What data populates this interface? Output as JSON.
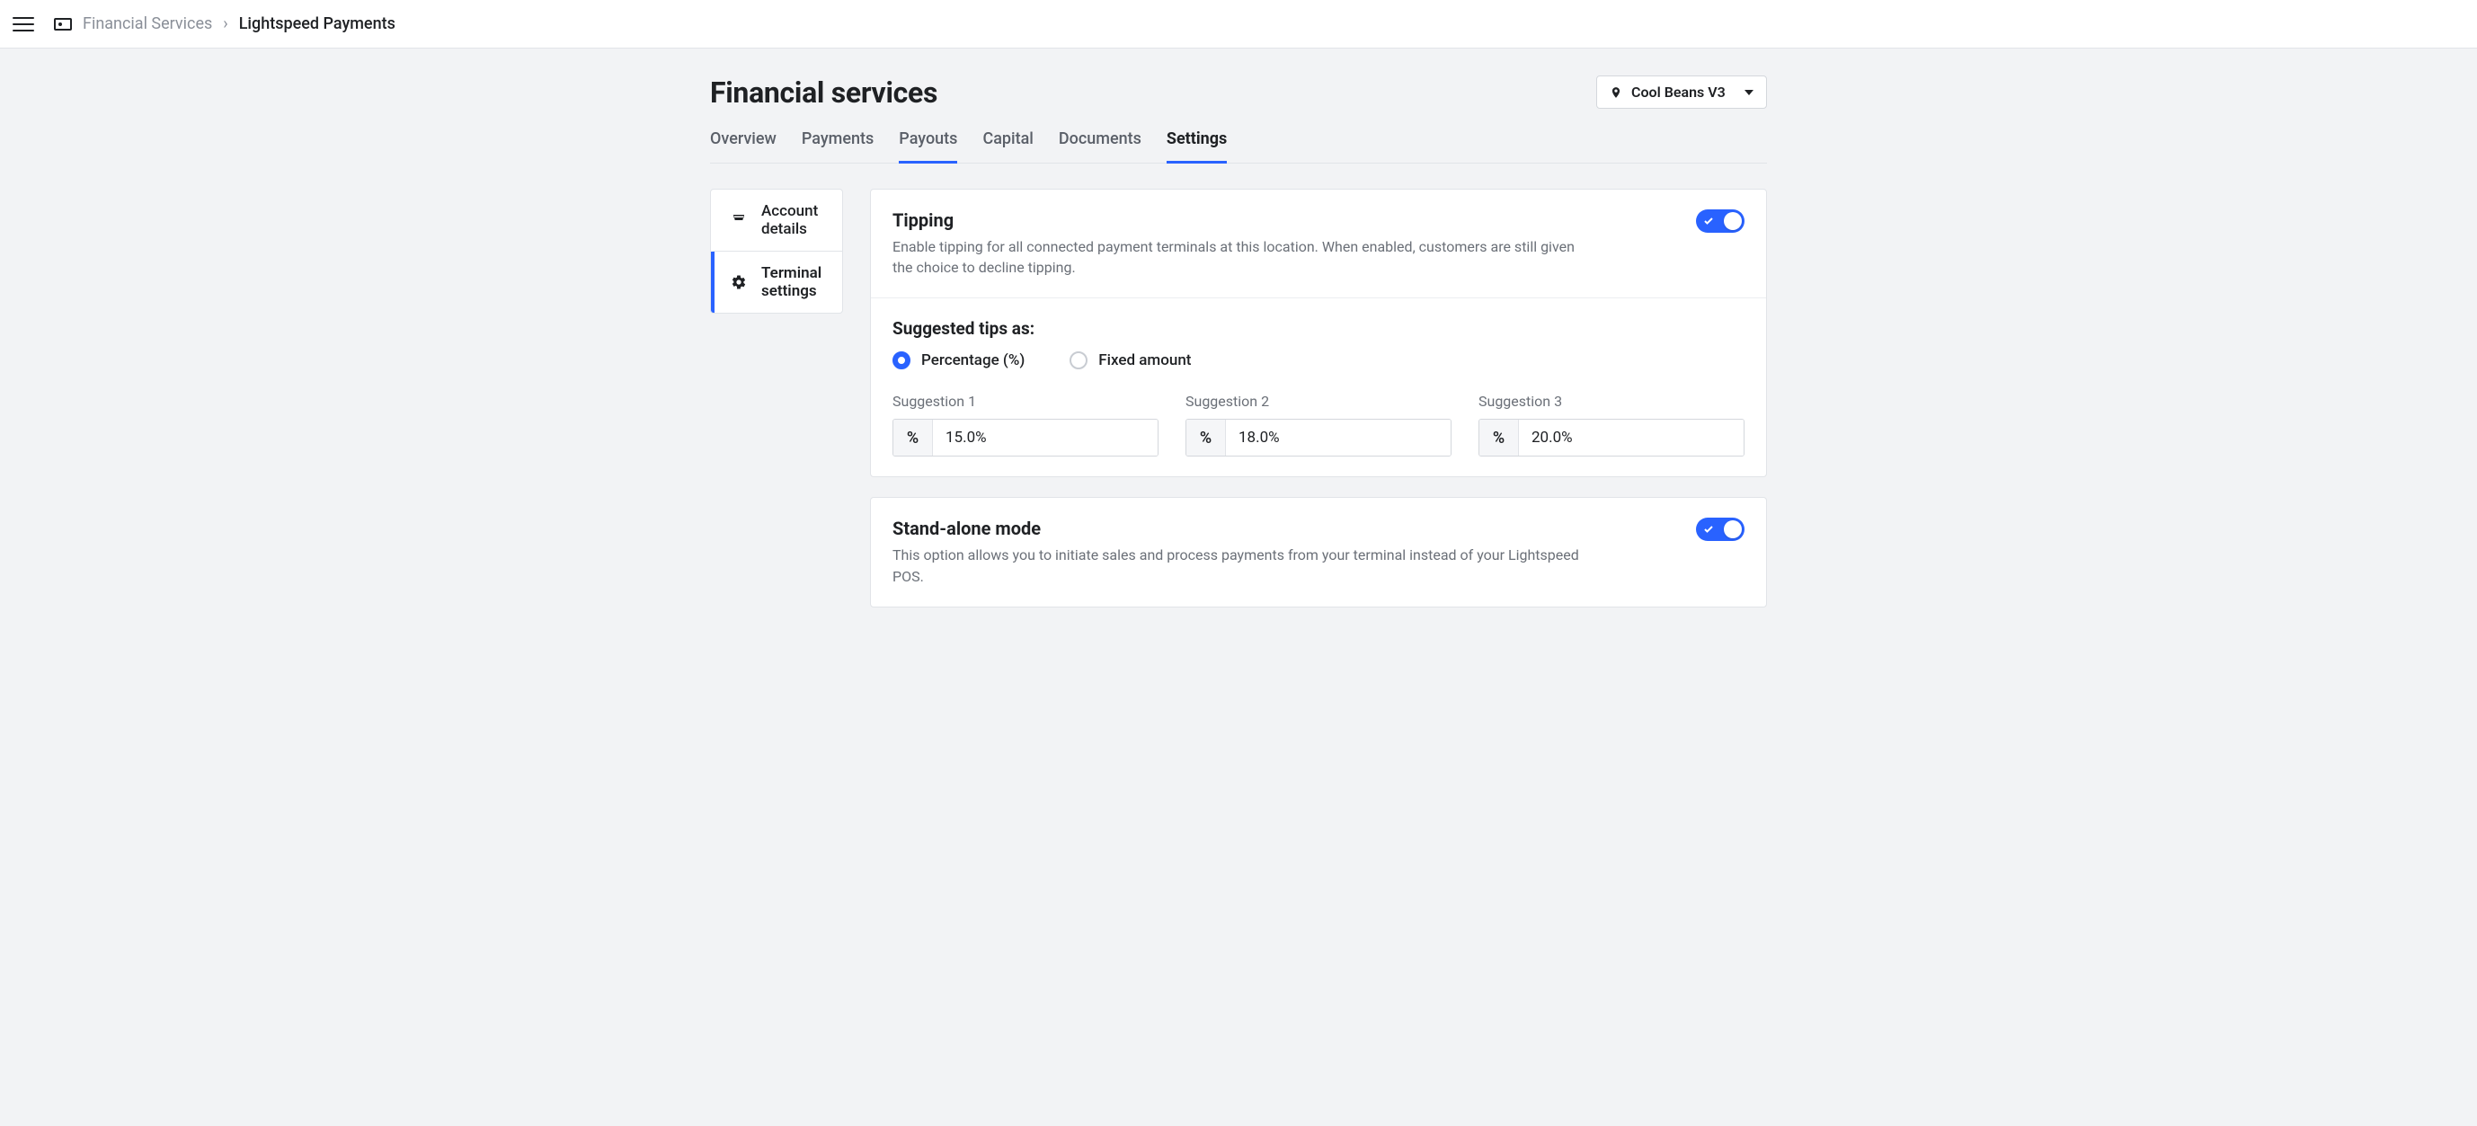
{
  "breadcrumb": {
    "section": "Financial Services",
    "current": "Lightspeed Payments"
  },
  "page": {
    "title": "Financial services",
    "location": "Cool Beans V3"
  },
  "tabs": [
    {
      "id": "overview",
      "label": "Overview",
      "active": false,
      "highlight": false
    },
    {
      "id": "payments",
      "label": "Payments",
      "active": false,
      "highlight": false
    },
    {
      "id": "payouts",
      "label": "Payouts",
      "active": false,
      "highlight": true
    },
    {
      "id": "capital",
      "label": "Capital",
      "active": false,
      "highlight": false
    },
    {
      "id": "documents",
      "label": "Documents",
      "active": false,
      "highlight": false
    },
    {
      "id": "settings",
      "label": "Settings",
      "active": true,
      "highlight": false
    }
  ],
  "settings_nav": [
    {
      "id": "account-details",
      "label": "Account details",
      "icon": "storefront-icon",
      "active": false
    },
    {
      "id": "terminal-settings",
      "label": "Terminal settings",
      "icon": "gear-icon",
      "active": true
    }
  ],
  "tipping": {
    "title": "Tipping",
    "description": "Enable tipping for all connected payment terminals at this location. When enabled, customers are still given the choice to decline tipping.",
    "enabled": true,
    "suggested_tips_heading": "Suggested tips as:",
    "mode": "percentage",
    "mode_options": {
      "percentage": "Percentage (%)",
      "fixed": "Fixed amount"
    },
    "suggestions": [
      {
        "label": "Suggestion 1",
        "prefix": "%",
        "value": "15.0%"
      },
      {
        "label": "Suggestion 2",
        "prefix": "%",
        "value": "18.0%"
      },
      {
        "label": "Suggestion 3",
        "prefix": "%",
        "value": "20.0%"
      }
    ]
  },
  "standalone": {
    "title": "Stand-alone mode",
    "description": "This option allows you to initiate sales and process payments from your terminal instead of your Lightspeed POS.",
    "enabled": true
  }
}
